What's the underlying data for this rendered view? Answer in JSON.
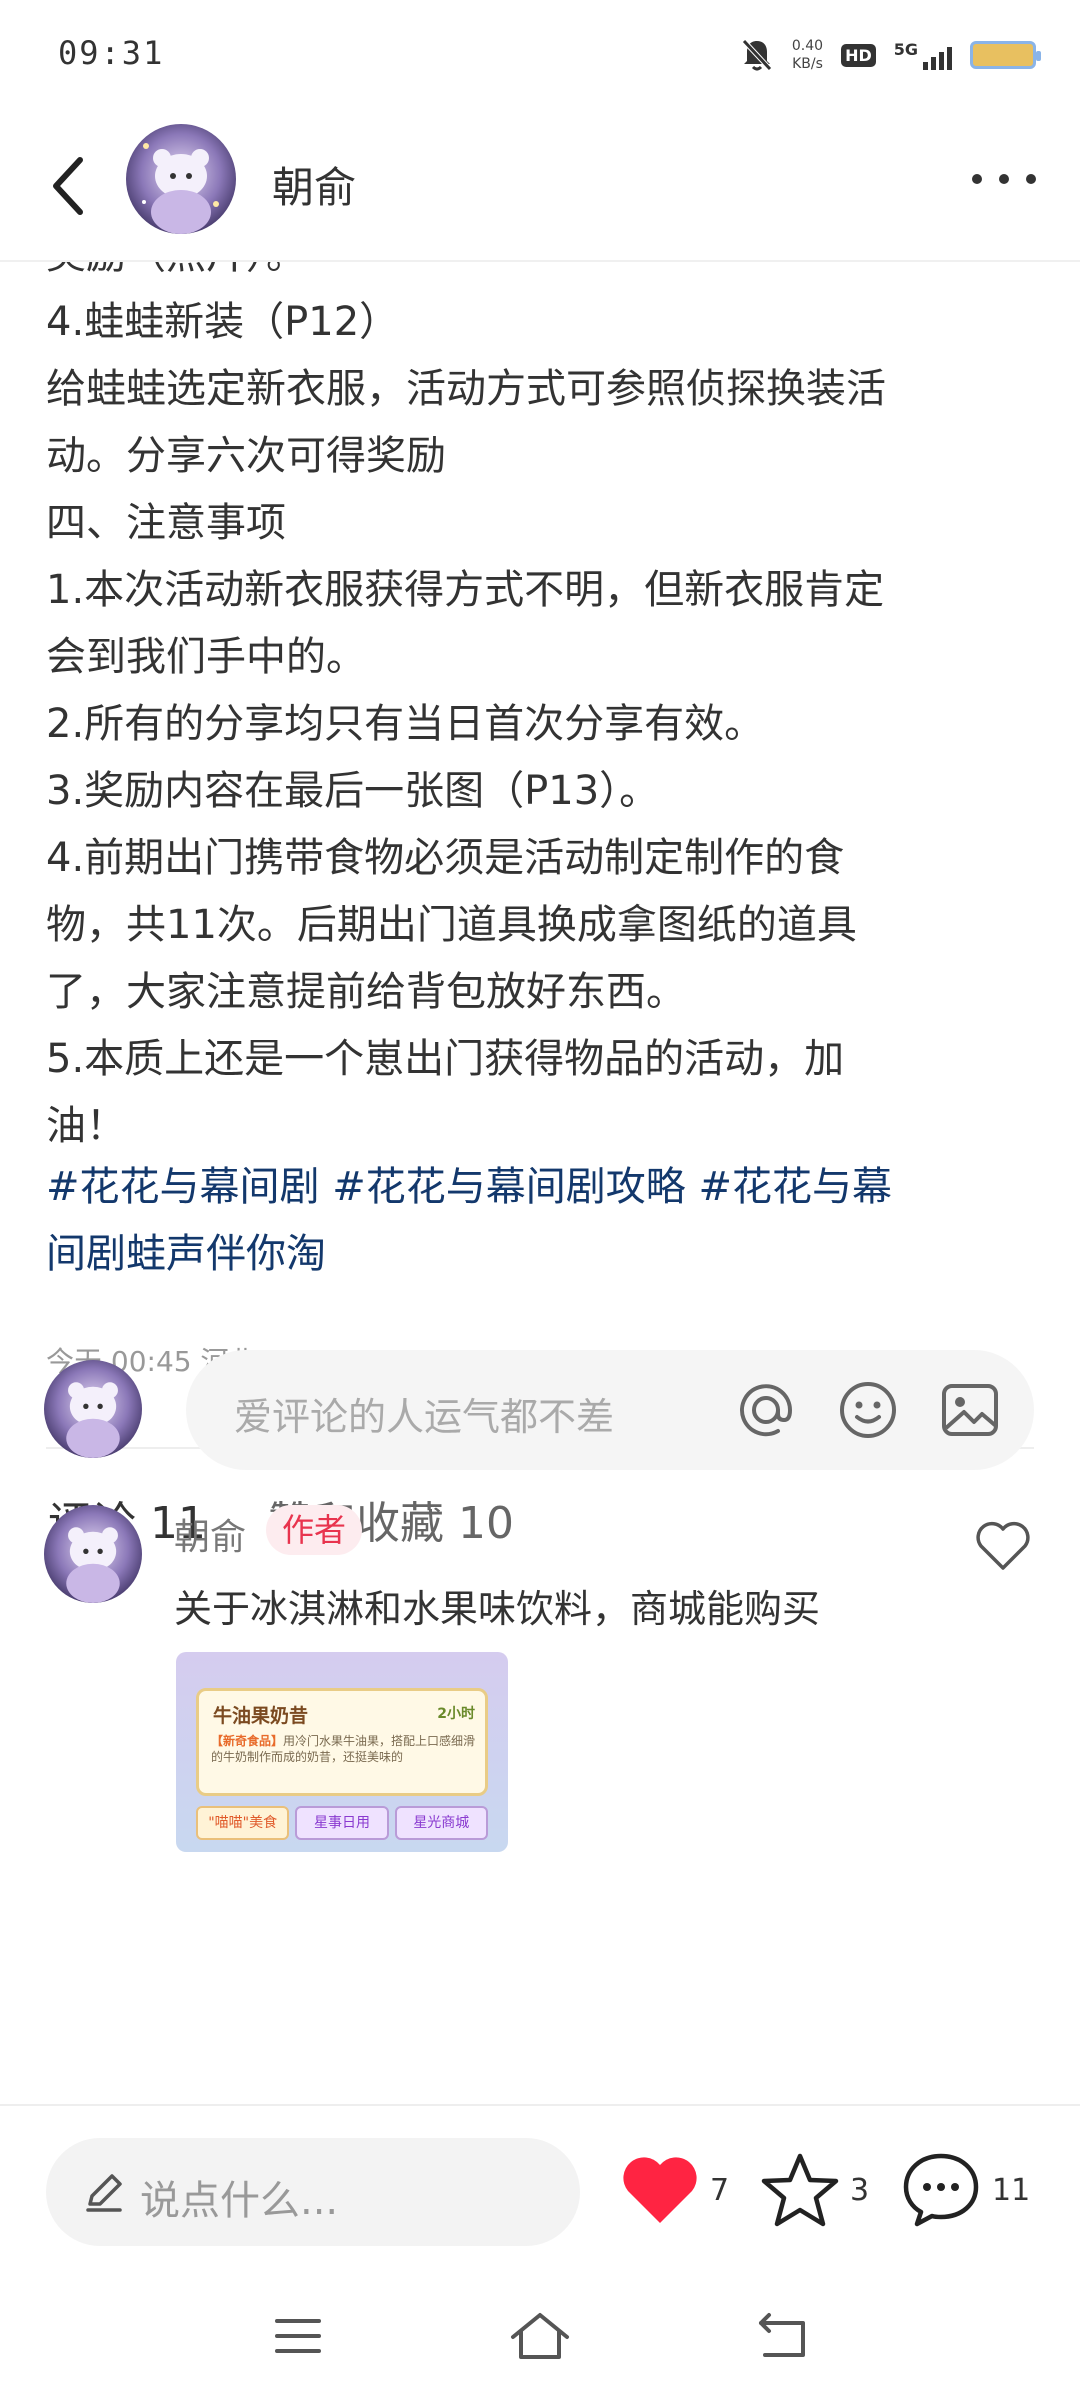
{
  "status_bar": {
    "time": "09:31",
    "net_speed_value": "0.40",
    "net_speed_unit": "KB/s",
    "hd": "HD",
    "network": "5G"
  },
  "header": {
    "author_name": "朝俞",
    "icons": [
      "back-icon",
      "avatar",
      "more-icon"
    ]
  },
  "post": {
    "lines": [
      "奖励（照片）。",
      "4.蛙蛙新装（P12）",
      "给蛙蛙选定新衣服，活动方式可参照侦探换装活",
      "动。分享六次可得奖励",
      "四、注意事项",
      "1.本次活动新衣服获得方式不明，但新衣服肯定",
      "会到我们手中的。",
      "2.所有的分享均只有当日首次分享有效。",
      "3.奖励内容在最后一张图（P13）。",
      "4.前期出门携带食物必须是活动制定制作的食",
      "物，共11次。后期出门道具换成拿图纸的道具",
      "了，大家注意提前给背包放好东西。",
      "5.本质上还是一个崽出门获得物品的活动，加",
      "油！"
    ],
    "hashtag_lines": [
      "#花花与幕间剧 #花花与幕间剧攻略 #花花与幕",
      "间剧蛙声伴你淘"
    ],
    "meta": "今天 00:45 河北"
  },
  "tabs": {
    "comments": "评论 11",
    "likes": "赞和收藏 10"
  },
  "composer": {
    "placeholder": "爱评论的人运气都不差",
    "icons": [
      "at-icon",
      "emoji-icon",
      "image-icon"
    ]
  },
  "comment": {
    "author": "朝俞",
    "badge": "作者",
    "text": "关于冰淇淋和水果味饮料，商城能购买",
    "image": {
      "title": "牛油果奶昔",
      "time": "2小时",
      "tag": "【新奇食品】",
      "desc": "用冷门水果牛油果，搭配上口感细滑的牛奶制作而成的奶昔，还挺美味的",
      "tabs": [
        "\"喵喵\"美食",
        "星事日用",
        "星光商城"
      ]
    }
  },
  "action_bar": {
    "placeholder": "说点什么...",
    "like_count": "7",
    "star_count": "3",
    "comment_count": "11",
    "colors": {
      "like": "#ff2442"
    }
  },
  "nav_bar": {
    "icons": [
      "menu-icon",
      "home-icon",
      "back-nav-icon"
    ]
  }
}
